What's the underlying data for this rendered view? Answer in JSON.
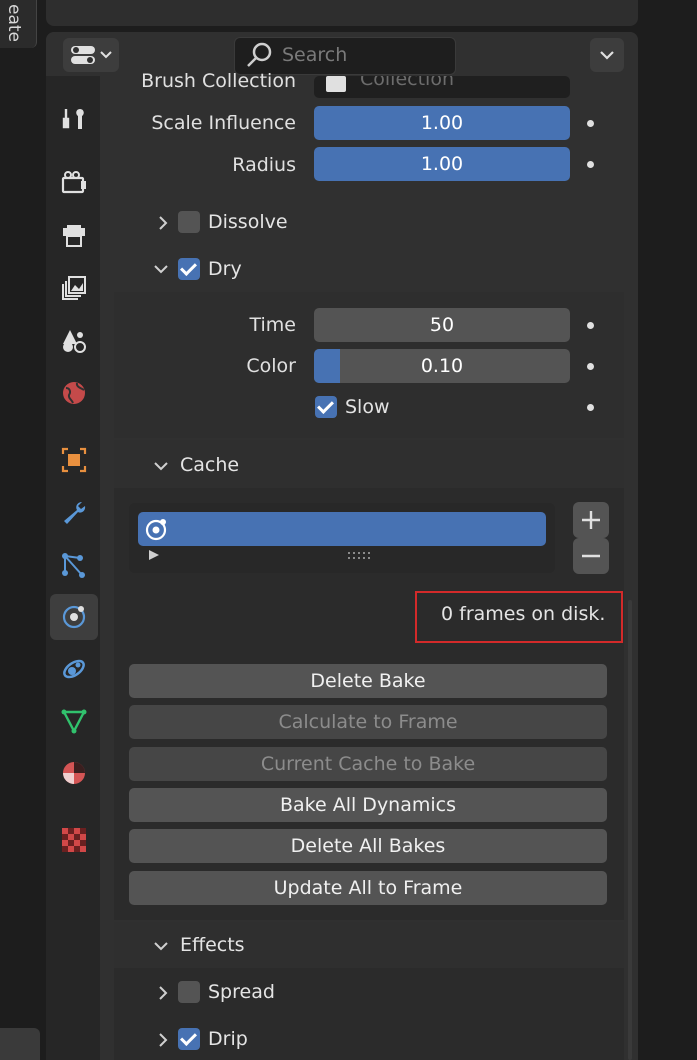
{
  "left_strip": {
    "tab_label": "eate"
  },
  "header": {
    "search_placeholder": "Search"
  },
  "dynamic_paint": {
    "brush_collection": {
      "label": "Brush Collection",
      "value": "Collection"
    },
    "scale_influence": {
      "label": "Scale Influence",
      "value": "1.00"
    },
    "radius": {
      "label": "Radius",
      "value": "1.00"
    },
    "dissolve": {
      "label": "Dissolve",
      "checked": false,
      "expanded": false
    },
    "dry": {
      "label": "Dry",
      "checked": true,
      "expanded": true,
      "time": {
        "label": "Time",
        "value": "50"
      },
      "color": {
        "label": "Color",
        "value": "0.10",
        "fraction": 0.1
      },
      "slow": {
        "label": "Slow",
        "checked": true
      }
    },
    "cache": {
      "label": "Cache",
      "status": "0 frames on disk.",
      "buttons": {
        "delete_bake": "Delete Bake",
        "calculate_to_frame": "Calculate to Frame",
        "current_cache_to_bake": "Current Cache to Bake",
        "bake_all_dynamics": "Bake All Dynamics",
        "delete_all_bakes": "Delete All Bakes",
        "update_all_to_frame": "Update All to Frame"
      }
    },
    "effects": {
      "label": "Effects",
      "spread": {
        "label": "Spread",
        "checked": false
      },
      "drip": {
        "label": "Drip",
        "checked": true
      }
    }
  },
  "tabs": [
    "tool-icon",
    "render-icon",
    "output-icon",
    "view-layer-icon",
    "scene-icon",
    "world-icon",
    "object-icon",
    "modifier-icon",
    "particles-icon",
    "physics-icon",
    "constraints-icon",
    "data-icon",
    "material-icon",
    "texture-icon"
  ],
  "colors": {
    "accent": "#4772b3",
    "highlight_box": "#d32a2a"
  }
}
